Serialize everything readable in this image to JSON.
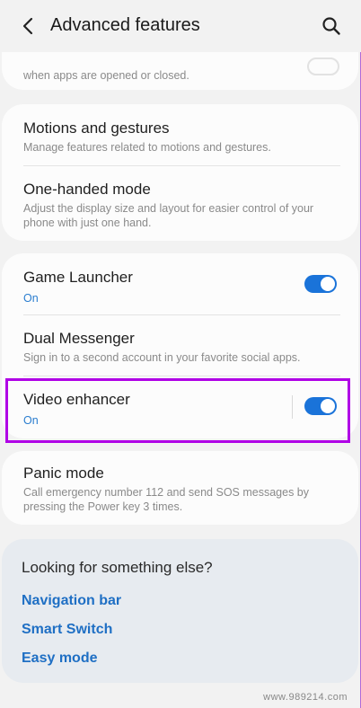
{
  "header": {
    "title": "Advanced features"
  },
  "partial_item": {
    "desc": "when apps are opened or closed."
  },
  "group1": {
    "items": [
      {
        "title": "Motions and gestures",
        "desc": "Manage features related to motions and gestures."
      },
      {
        "title": "One-handed mode",
        "desc": "Adjust the display size and layout for easier control of your phone with just one hand."
      }
    ]
  },
  "group2": {
    "items": [
      {
        "title": "Game Launcher",
        "status": "On",
        "toggle": "on"
      },
      {
        "title": "Dual Messenger",
        "desc": "Sign in to a second account in your favorite social apps."
      },
      {
        "title": "Video enhancer",
        "status": "On",
        "toggle": "on"
      }
    ]
  },
  "group3": {
    "items": [
      {
        "title": "Panic mode",
        "desc": "Call emergency number 112 and send SOS messages by pressing the Power key 3 times."
      }
    ]
  },
  "suggestions": {
    "title": "Looking for something else?",
    "links": [
      "Navigation bar",
      "Smart Switch",
      "Easy mode"
    ]
  },
  "watermark": "www.989214.com",
  "colors": {
    "accent": "#1a73d9",
    "highlight": "#b000e6",
    "link": "#1f6fc4"
  }
}
